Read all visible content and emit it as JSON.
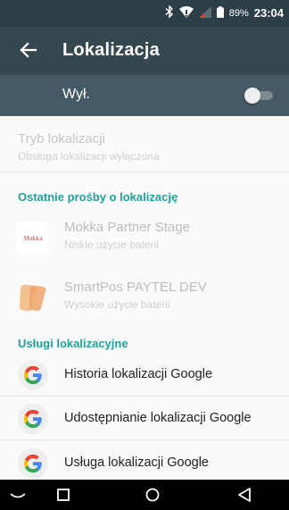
{
  "status_bar": {
    "battery": "89%",
    "time": "23:04",
    "icons": [
      "bluetooth-icon",
      "wifi-icon",
      "signal-icon",
      "battery-icon"
    ]
  },
  "toolbar": {
    "title": "Lokalizacja",
    "back_icon": "arrow-back-icon"
  },
  "master_switch": {
    "label": "Wył.",
    "enabled": false
  },
  "location_mode": {
    "title": "Tryb lokalizacji",
    "subtitle": "Obsługa lokalizacji wyłączona"
  },
  "recent_requests": {
    "header": "Ostatnie prośby o lokalizację",
    "items": [
      {
        "name": "Mokka Partner Stage",
        "usage": "Niskie użycie baterii",
        "icon_text": "Mokka"
      },
      {
        "name": "SmartPos PAYTEL DEV",
        "usage": "Wysokie użycie baterii",
        "icon_text": ""
      }
    ]
  },
  "services": {
    "header": "Usługi lokalizacyjne",
    "items": [
      {
        "label": "Historia lokalizacji Google",
        "icon": "google-icon"
      },
      {
        "label": "Udostępnianie lokalizacji Google",
        "icon": "google-icon"
      },
      {
        "label": "Usługa lokalizacji Google",
        "icon": "google-icon"
      }
    ]
  },
  "nav_bar": {
    "icons": [
      "nav-collapse-icon",
      "recents-icon",
      "home-icon",
      "back-icon"
    ]
  },
  "colors": {
    "status_bar": "#2e3e47",
    "toolbar": "#37474f",
    "switch_bar": "#455a64",
    "accent": "#1fa398"
  }
}
